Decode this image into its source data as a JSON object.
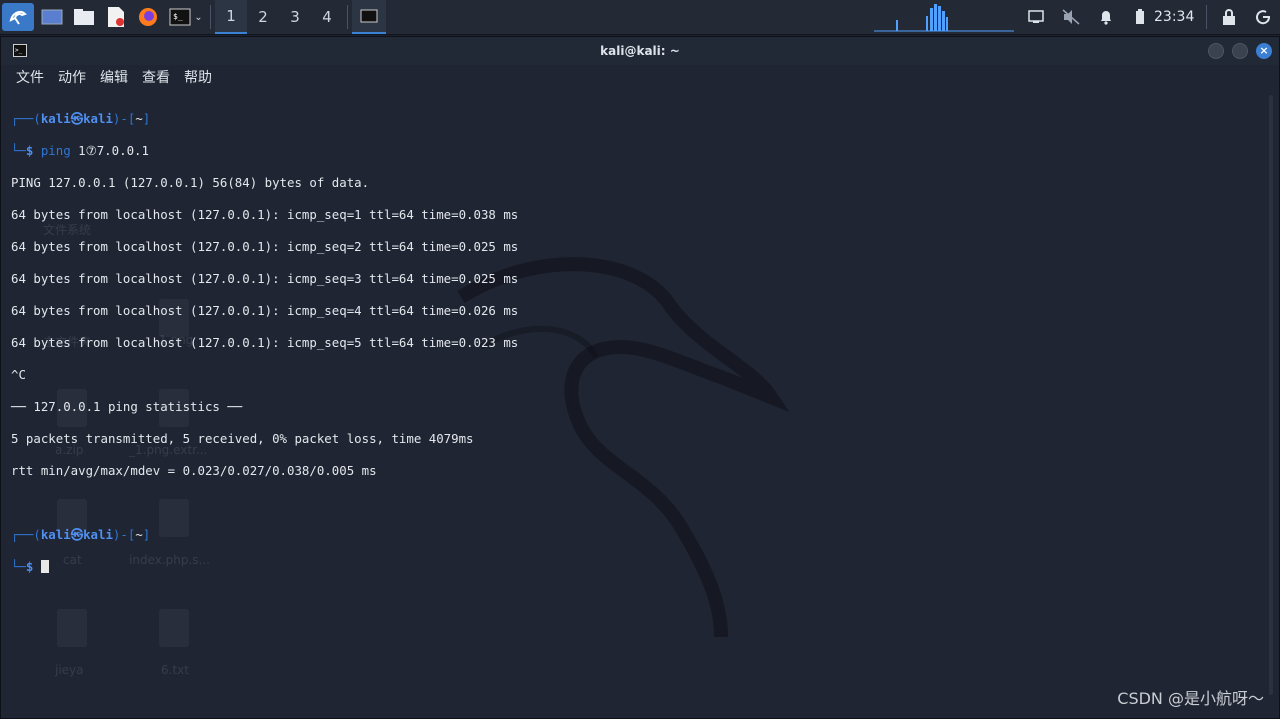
{
  "panel": {
    "workspaces": [
      "1",
      "2",
      "3",
      "4"
    ],
    "active_workspace": "1",
    "clock": "23:34"
  },
  "window": {
    "title": "kali@kali: ~"
  },
  "menu": [
    "文件",
    "动作",
    "编辑",
    "查看",
    "帮助"
  ],
  "terminal": {
    "prompt_user": "kali",
    "prompt_at": "㉿",
    "prompt_host": "kali",
    "prompt_dir": "~",
    "command": "ping 1⑦7.0.0.1",
    "output": [
      "PING 127.0.0.1 (127.0.0.1) 56(84) bytes of data.",
      "64 bytes from localhost (127.0.0.1): icmp_seq=1 ttl=64 time=0.038 ms",
      "64 bytes from localhost (127.0.0.1): icmp_seq=2 ttl=64 time=0.025 ms",
      "64 bytes from localhost (127.0.0.1): icmp_seq=3 ttl=64 time=0.025 ms",
      "64 bytes from localhost (127.0.0.1): icmp_seq=4 ttl=64 time=0.026 ms",
      "64 bytes from localhost (127.0.0.1): icmp_seq=5 ttl=64 time=0.023 ms",
      "^C",
      "── 127.0.0.1 ping statistics ──",
      "5 packets transmitted, 5 received, 0% packet loss, time 4079ms",
      "rtt min/avg/max/mdev = 0.023/0.027/0.038/0.005 ms"
    ]
  },
  "desktop_ghost": [
    "文件系统",
    "主文件夹",
    "1.png",
    "a.zip",
    "_1.png.extr...",
    "cat",
    "index.php.s...",
    "jieya",
    "6.txt"
  ],
  "watermark": "CSDN @是小航呀～",
  "colors": {
    "accent": "#3b82d6",
    "prompt": "#2f76d2",
    "panel": "#232a36",
    "terminal_bg": "#1f2533"
  }
}
